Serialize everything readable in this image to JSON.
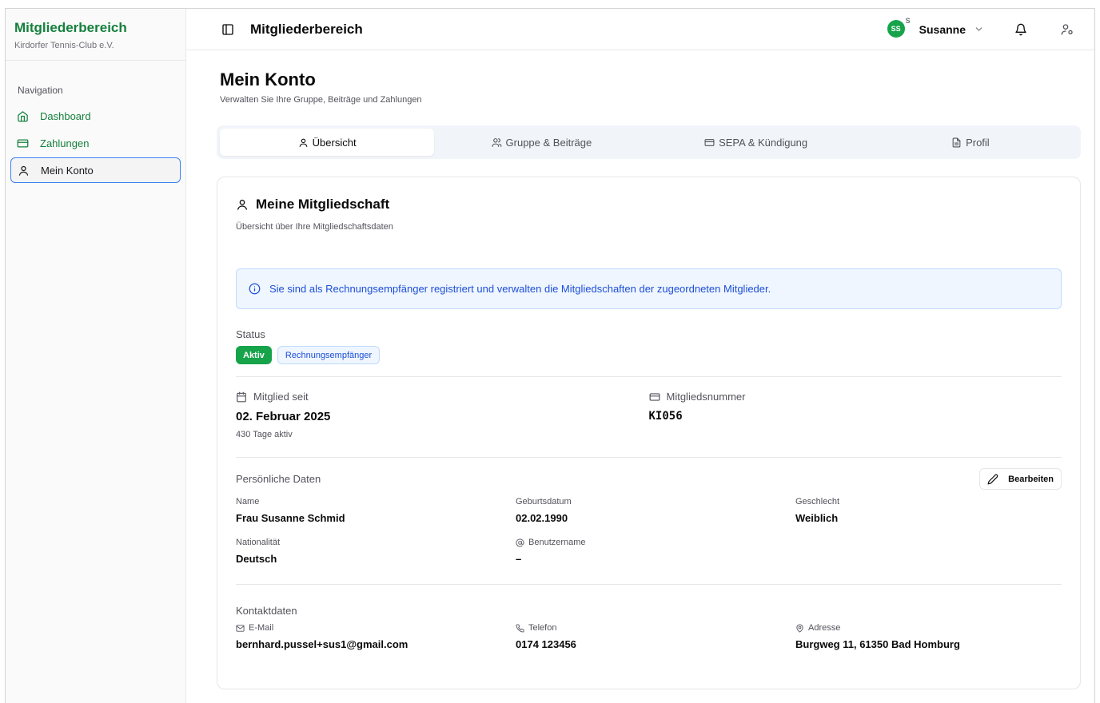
{
  "sidebar": {
    "brand_title": "Mitgliederbereich",
    "brand_sub": "Kirdorfer Tennis-Club e.V.",
    "nav_label": "Navigation",
    "items": [
      {
        "label": "Dashboard",
        "icon": "home-icon"
      },
      {
        "label": "Zahlungen",
        "icon": "credit-card-icon"
      },
      {
        "label": "Mein Konto",
        "icon": "user-icon",
        "active": true
      }
    ]
  },
  "topbar": {
    "title": "Mitgliederbereich",
    "avatar_initials": "SS",
    "avatar_sup": "S",
    "user_name": "Susanne"
  },
  "page": {
    "title": "Mein Konto",
    "subtitle": "Verwalten Sie Ihre Gruppe, Beiträge und Zahlungen"
  },
  "tabs": [
    {
      "label": "Übersicht",
      "active": true
    },
    {
      "label": "Gruppe & Beiträge"
    },
    {
      "label": "SEPA & Kündigung"
    },
    {
      "label": "Profil"
    }
  ],
  "card": {
    "title": "Meine Mitgliedschaft",
    "subtitle": "Übersicht über Ihre Mitgliedschaftsdaten",
    "info": "Sie sind als Rechnungsempfänger registriert und verwalten die Mitgliedschaften der zugeordneten Mitglieder.",
    "status_label": "Status",
    "badges": [
      "Aktiv",
      "Rechnungsempfänger"
    ],
    "member_since_label": "Mitglied seit",
    "member_since_value": "02. Februar 2025",
    "member_since_days": "430 Tage aktiv",
    "member_number_label": "Mitgliedsnummer",
    "member_number_value": "KI056",
    "personal_title": "Persönliche Daten",
    "edit_label": "Bearbeiten",
    "personal": {
      "name_label": "Name",
      "name_value": "Frau Susanne Schmid",
      "birth_label": "Geburtsdatum",
      "birth_value": "02.02.1990",
      "gender_label": "Geschlecht",
      "gender_value": "Weiblich",
      "nation_label": "Nationalität",
      "nation_value": "Deutsch",
      "user_label": "Benutzername",
      "user_value": "–"
    },
    "contact_title": "Kontaktdaten",
    "contact": {
      "email_label": "E-Mail",
      "email_value": "bernhard.pussel+sus1@gmail.com",
      "phone_label": "Telefon",
      "phone_value": "0174 123456",
      "address_label": "Adresse",
      "address_value": "Burgweg 11, 61350 Bad Homburg"
    }
  },
  "colors": {
    "brand": "#15803d",
    "accent": "#16a34a",
    "info": "#1d4ed8"
  }
}
